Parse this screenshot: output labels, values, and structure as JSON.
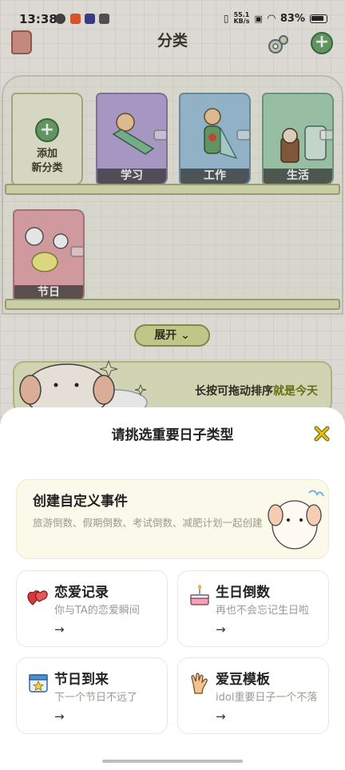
{
  "status_bar": {
    "time": "13:38",
    "net_speed_value": "55.1",
    "net_speed_unit": "KB/s",
    "battery": "83%"
  },
  "header": {
    "title": "分类"
  },
  "shelf": {
    "add_label_line1": "添加",
    "add_label_line2": "新分类",
    "categories": [
      {
        "label": "学习",
        "color": "#b8a6d8"
      },
      {
        "label": "工作",
        "color": "#9fc4dc"
      },
      {
        "label": "生活",
        "color": "#a7d3b3"
      },
      {
        "label": "节日",
        "color": "#e7a9ae"
      }
    ],
    "expand_label": "展开"
  },
  "hint": {
    "text_main": "长按可拖动排序",
    "text_highlight": "就是今天"
  },
  "sheet": {
    "title": "请挑选重要日子类型",
    "custom": {
      "title": "创建自定义事件",
      "desc": "旅游倒数、假期倒数、考试倒数、减肥计划一起创建"
    },
    "types": [
      {
        "title": "恋爱记录",
        "desc": "你与TA的恋爱瞬间",
        "arrow": "→",
        "icon": "hearts-icon"
      },
      {
        "title": "生日倒数",
        "desc": "再也不会忘记生日啦",
        "arrow": "→",
        "icon": "cake-icon"
      },
      {
        "title": "节日到来",
        "desc": "下一个节日不远了",
        "arrow": "→",
        "icon": "calendar-star-icon"
      },
      {
        "title": "爱豆模板",
        "desc": "idol重要日子一个不落",
        "arrow": "→",
        "icon": "hand-gesture-icon"
      }
    ]
  },
  "colors": {
    "accent_green": "#6aa36a",
    "highlight_olive": "#6e7a12",
    "close_yellow": "#e9c200"
  }
}
